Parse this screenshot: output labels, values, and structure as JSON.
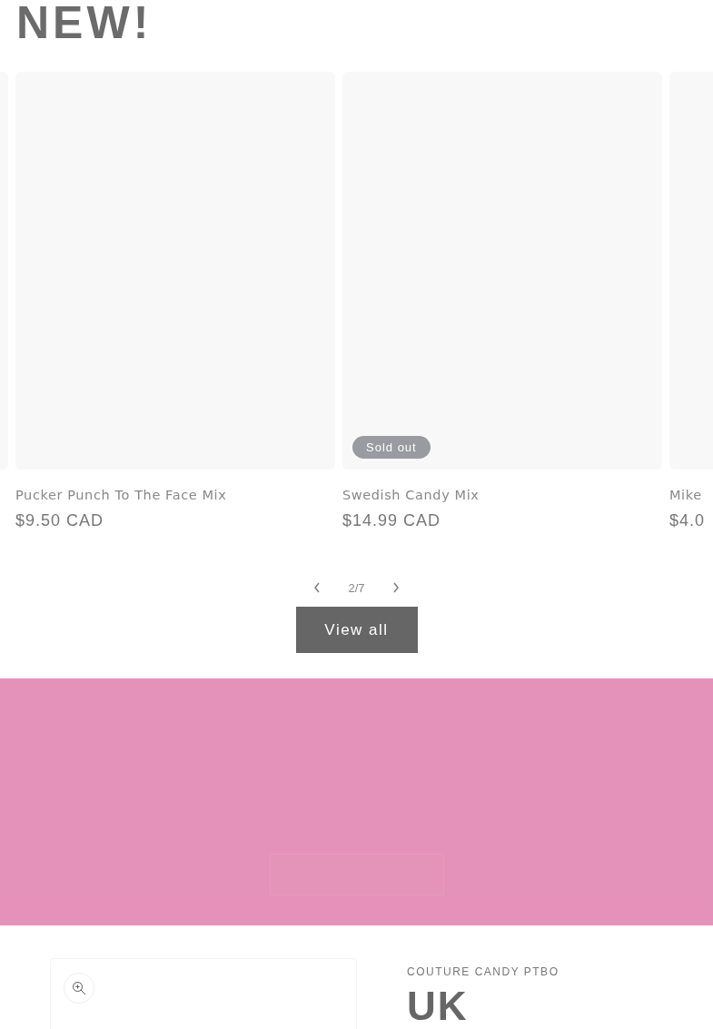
{
  "section_heading": "NEW!",
  "products": [
    {
      "sold_out": false
    },
    {
      "title": "Pucker Punch To The Face Mix",
      "price": "$9.50 CAD",
      "sold_out": false
    },
    {
      "title": "Swedish Candy Mix",
      "price": "$14.99 CAD",
      "sold_out": true,
      "badge": "Sold out"
    },
    {
      "title": "Mike",
      "price": "$4.0",
      "sold_out": false
    }
  ],
  "pagination": {
    "counter": "2/7"
  },
  "view_all_button": "View all",
  "product_detail": {
    "vendor": "COUTURE CANDY PTBO",
    "title": "UK"
  }
}
